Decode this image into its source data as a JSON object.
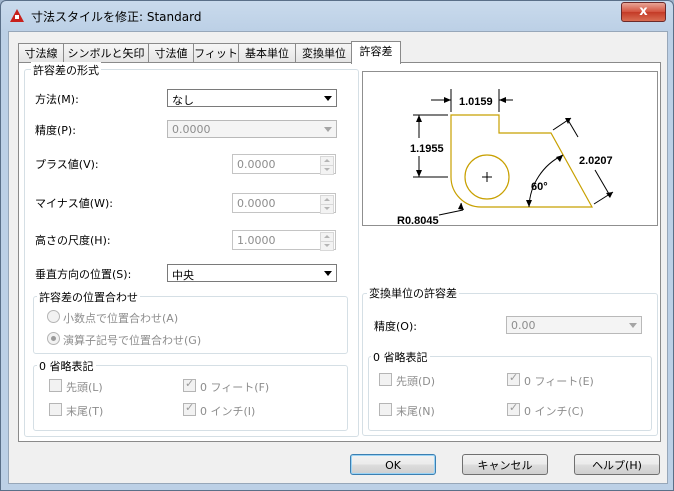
{
  "window": {
    "title": "寸法スタイルを修正: Standard",
    "close_glyph": "x"
  },
  "tabs": [
    {
      "label": "寸法線"
    },
    {
      "label": "シンボルと矢印"
    },
    {
      "label": "寸法値"
    },
    {
      "label": "フィット"
    },
    {
      "label": "基本単位"
    },
    {
      "label": "変換単位"
    },
    {
      "label": "許容差"
    }
  ],
  "tolerance_format": {
    "title": "許容差の形式",
    "method": {
      "label": "方法(M):",
      "value": "なし"
    },
    "precision": {
      "label": "精度(P):",
      "value": "0.0000"
    },
    "upper_value": {
      "label": "プラス値(V):",
      "value": "0.0000"
    },
    "lower_value": {
      "label": "マイナス値(W):",
      "value": "0.0000"
    },
    "height_scale": {
      "label": "高さの尺度(H):",
      "value": "1.0000"
    },
    "vertical_position": {
      "label": "垂直方向の位置(S):",
      "value": "中央"
    }
  },
  "alignment": {
    "title": "許容差の位置合わせ",
    "align_decimal": "小数点で位置合わせ(A)",
    "align_operator": "演算子記号で位置合わせ(G)"
  },
  "zero_suppression_left": {
    "title": "0 省略表記",
    "leading": "先頭(L)",
    "trailing": "末尾(T)",
    "feet": "0 フィート(F)",
    "inches": "0 インチ(I)"
  },
  "alt_unit_tolerance": {
    "title": "変換単位の許容差",
    "precision": {
      "label": "精度(O):",
      "value": "0.00"
    }
  },
  "zero_suppression_right": {
    "title": "0 省略表記",
    "leading": "先頭(D)",
    "trailing": "末尾(N)",
    "feet": "0 フィート(E)",
    "inches": "0 インチ(C)"
  },
  "preview": {
    "dim_top": "1.0159",
    "dim_left": "1.1955",
    "dim_right": "2.0207",
    "angle": "60°",
    "radius": "R0.8045",
    "center_mark": "+"
  },
  "buttons": {
    "ok": "OK",
    "cancel": "キャンセル",
    "help": "ヘルプ(H)"
  },
  "colors": {
    "shape_stroke": "#c8a000",
    "title_icon": "#c8201c"
  }
}
